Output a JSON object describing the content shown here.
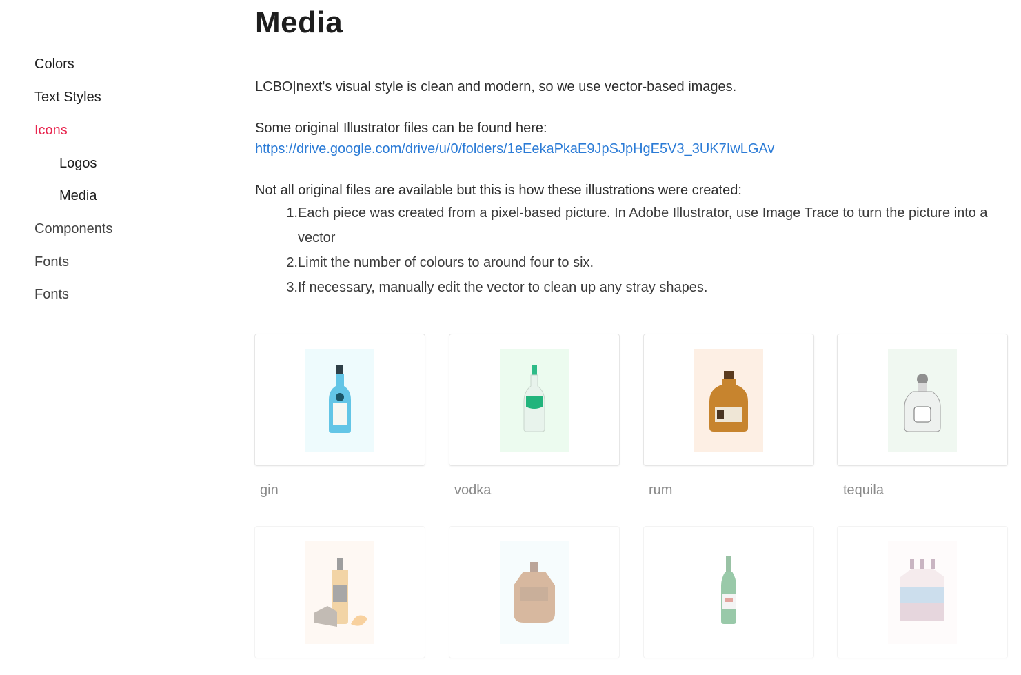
{
  "sidebar": {
    "items": [
      {
        "label": "Colors"
      },
      {
        "label": "Text Styles"
      },
      {
        "label": "Icons"
      },
      {
        "label": "Logos"
      },
      {
        "label": "Media"
      },
      {
        "label": "Components"
      },
      {
        "label": "Fonts"
      },
      {
        "label": "Fonts"
      }
    ]
  },
  "main": {
    "title": "Media",
    "intro": "LCBO|next's visual style is clean and modern, so we use vector-based images.",
    "files_label": "Some original Illustrator files can be found here:",
    "files_link": "https://drive.google.com/drive/u/0/folders/1eEekaPkaE9JpSJpHgE5V3_3UK7IwLGAv",
    "process_intro": "Not all original files are available but this is how these illustrations were created:",
    "steps": [
      {
        "num": "1.",
        "text": "Each piece was created from a pixel-based picture. In Adobe Illustrator, use Image Trace to turn the picture into a vector"
      },
      {
        "num": "2.",
        "text": "Limit the number of colours to around four to six."
      },
      {
        "num": "3.",
        "text": "If necessary, manually edit the vector to clean up any stray shapes."
      }
    ],
    "media": [
      {
        "caption": "gin",
        "icon": "gin-bottle-icon",
        "bg": "#eefbfd"
      },
      {
        "caption": "vodka",
        "icon": "vodka-bottle-icon",
        "bg": "#ecfbef"
      },
      {
        "caption": "rum",
        "icon": "rum-bottle-icon",
        "bg": "#fdefe4"
      },
      {
        "caption": "tequila",
        "icon": "tequila-bottle-icon",
        "bg": "#f0f8f1"
      },
      {
        "caption": "",
        "icon": "whisky-bottle-icon",
        "bg": "#fdf1e6"
      },
      {
        "caption": "",
        "icon": "crown-royal-bottle-icon",
        "bg": "#ecf9fb"
      },
      {
        "caption": "",
        "icon": "beer-bottle-icon",
        "bg": "#ffffff"
      },
      {
        "caption": "",
        "icon": "beer-six-pack-icon",
        "bg": "#fdf7f7"
      }
    ]
  }
}
